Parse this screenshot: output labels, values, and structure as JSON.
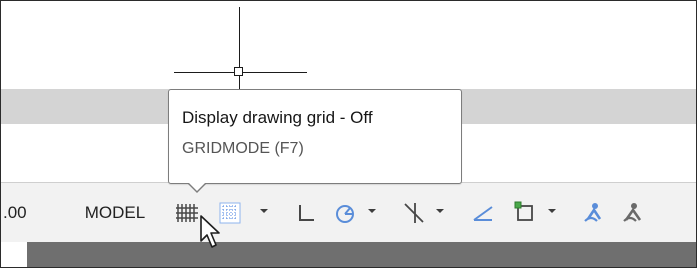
{
  "statusbar": {
    "coordinate_fragment": ".00",
    "model_label": "MODEL",
    "icons": {
      "grid_display_icon": "grid-display-icon",
      "snap_mode_icon": "snap-mode-icon",
      "ortho_icon": "ortho-icon",
      "polar_tracking_icon": "polar-tracking-icon",
      "object_snap_tracking_icon": "object-snap-tracking-icon",
      "isometric_drafting_icon": "isometric-drafting-icon",
      "selection_cycling_icon": "selection-cycling-icon",
      "annotation_visibility_icon": "annotation-visibility-icon"
    }
  },
  "tooltip": {
    "title": "Display drawing grid - Off",
    "subtitle": "GRIDMODE (F7)"
  },
  "colors": {
    "status_bar_bg": "#f2f2f2",
    "gray_band": "#d4d4d4",
    "tooltip_border": "#7d7d7d",
    "selected_icon_blue": "#5a8dd9",
    "accent_green": "#4aa84a",
    "dark_shadow": "#6f6f6f"
  }
}
